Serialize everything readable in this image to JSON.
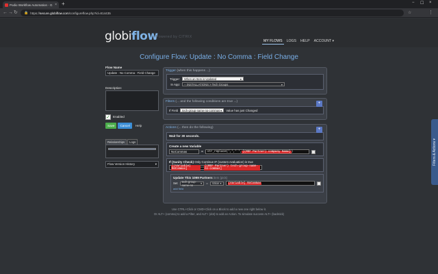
{
  "browser": {
    "tab_title": "Podio Workflow Automation - G",
    "tab_close": "×",
    "new_tab": "+",
    "win_min": "−",
    "win_max": "☐",
    "win_close": "×",
    "back": "←",
    "forward": "→",
    "reload": "↻",
    "url_scheme": "https://",
    "url_host": "secure.globiflow.com",
    "url_path": "/configureflow.php?id=814435",
    "star": "☆",
    "menu": "⋮"
  },
  "site": {
    "logo_part1": "globi",
    "logo_part2": "flow",
    "logo_sub": "Powered by CITRIX",
    "nav": [
      "MY FLOWS",
      "LOGS",
      "HELP",
      "ACCOUNT ▾"
    ]
  },
  "page_title": "Configure Flow: Update : No Comma : Field Change",
  "left": {
    "flow_name_label": "Flow Name",
    "flow_name_value": "Update : No Comma : Field Change",
    "description_label": "Description:",
    "enabled_check": "✓",
    "enabled_label": "Enabled",
    "save": "Save",
    "cancel": "Cancel",
    "help": "Help",
    "tabs": [
      "Relationships",
      "Logs"
    ],
    "version_select": "Flow Version History",
    "select_arrow": "▾"
  },
  "trigger": {
    "head_main": "Trigger",
    "head_sub": "(when this happens ...)",
    "trigger_label": "Trigger:",
    "trigger_value": "When an Item is Updated",
    "in_app_label": "In App:",
    "in_app_value": "-- INSTALLATIONS > Tech Groups",
    "arrow": "▾"
  },
  "filters": {
    "head_main": "Filters",
    "head_sub": "(... and the following conditions are true ...)",
    "plus": "+",
    "if_field": "If Field",
    "field_value": "tech-group-name-no-commas",
    "condition": "Value has just Changed"
  },
  "actions": {
    "head_main": "Actions",
    "head_sub": "(... then do the following)",
    "plus": "+",
    "wait": "Wait for 30 seconds.",
    "create_var_title": "Create a new Variable",
    "var_name": "NoCommas",
    "equals": "=",
    "code_prefix": "str_replace(',',' ',",
    "code_token": "[(REF Partner) company Name]",
    "code_suffix": ")",
    "if_title": "If (Sanity Check)",
    "if_desc": "Only Continue IF (custom evaluation) is true",
    "cond_token1": "[(Variable) NoCommas]",
    "cond_op": "==",
    "cond_token2": "[(REF Partner) tech-group-name-no-commas]",
    "update_title": "Update This 1099 Partners",
    "update_sub": "item",
    "update_sub2": "(pick)",
    "update_field": "tech-group-name-no",
    "update_mode": "Value",
    "update_value_token": "[Variable] NoCommas",
    "set_label": "Set",
    "add_field": "add field"
  },
  "footer": {
    "line1": "Use CTRL+Click or CMD+Click on a Block to add a new one right below it.",
    "line2": "Or ALT+ (comma) to add a Filter, and ALT+ (dot) to add an Action. To simulate success ALT+ (backtick)"
  },
  "side_tab": "Filters & Actions ▾"
}
